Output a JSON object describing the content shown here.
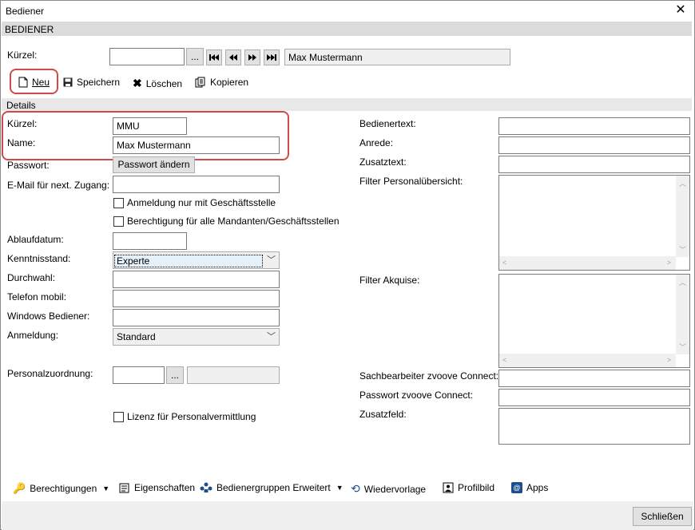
{
  "window": {
    "title": "Bediener",
    "close_label": "✕"
  },
  "section_header": "BEDIENER",
  "top": {
    "kuerzel_label": "Kürzel:",
    "kuerzel_value": "",
    "browse_label": "...",
    "nav_first": "⏮",
    "nav_prev": "◀◀",
    "nav_next": "▶▶",
    "nav_last": "⏭",
    "name_display": "Max Mustermann"
  },
  "toolbar": {
    "new_label": "Neu",
    "save_label": "Speichern",
    "delete_label": "Löschen",
    "copy_label": "Kopieren"
  },
  "details_header": "Details",
  "form": {
    "kuerzel_label": "Kürzel:",
    "kuerzel_value": "MMU",
    "name_label": "Name:",
    "name_value": "Max Mustermann",
    "passwort_label": "Passwort:",
    "passwort_button": "Passwort ändern",
    "email_label": "E-Mail für next. Zugang:",
    "email_value": "",
    "chk_anmeldung": "Anmeldung nur mit Geschäftsstelle",
    "chk_berechtigung": "Berechtigung für alle Mandanten/Geschäftsstellen",
    "ablauf_label": "Ablaufdatum:",
    "ablauf_value": "",
    "kenntnis_label": "Kenntnisstand:",
    "kenntnis_value": "Experte",
    "durchwahl_label": "Durchwahl:",
    "durchwahl_value": "",
    "telefon_label": "Telefon mobil:",
    "telefon_value": "",
    "windows_label": "Windows Bediener:",
    "windows_value": "",
    "anmeldung_label": "Anmeldung:",
    "anmeldung_value": "Standard",
    "personal_label": "Personalzuordnung:",
    "personal_value": "",
    "personal_browse": "...",
    "personal_display": "",
    "chk_lizenz": "Lizenz für Personalvermittlung"
  },
  "right": {
    "bedienertext_label": "Bedienertext:",
    "anrede_label": "Anrede:",
    "zusatztext_label": "Zusatztext:",
    "filter_personal_label": "Filter Personalübersicht:",
    "filter_akquise_label": "Filter Akquise:",
    "sachbearbeiter_label": "Sachbearbeiter zvoove Connect:",
    "passwort_connect_label": "Passwort zvoove Connect:",
    "zusatzfeld_label": "Zusatzfeld:"
  },
  "bottom": {
    "berechtigungen": "Berechtigungen",
    "eigenschaften": "Eigenschaften",
    "bedienergruppen": "Bedienergruppen Erweitert",
    "wiedervorlage": "Wiedervorlage",
    "profilbild": "Profilbild",
    "apps": "Apps"
  },
  "close_button": "Schließen"
}
